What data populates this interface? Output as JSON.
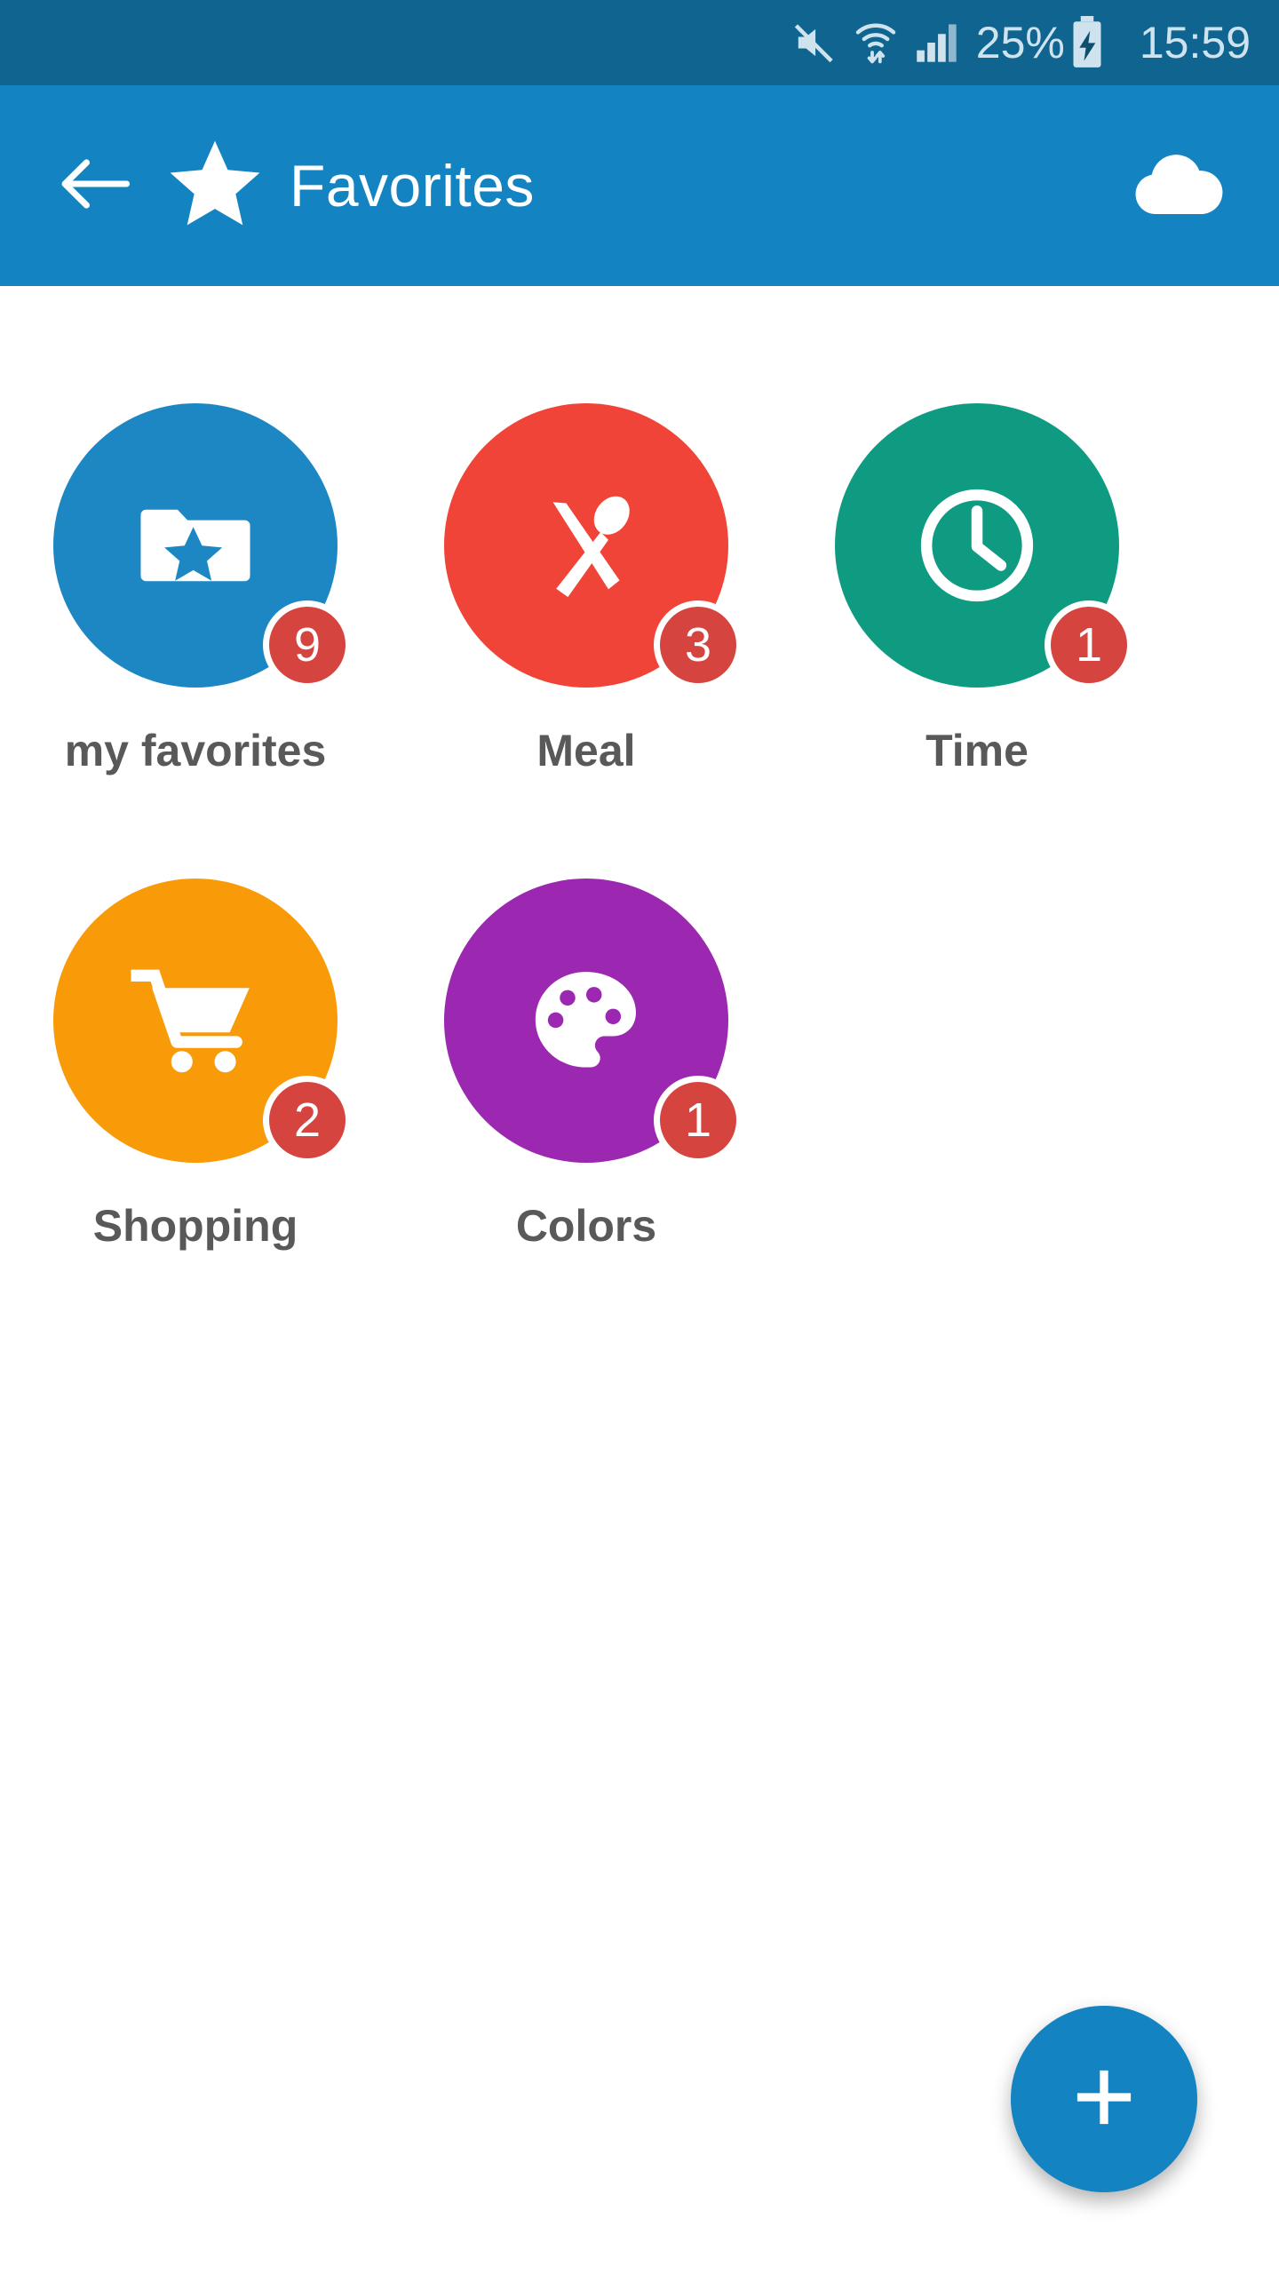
{
  "status_bar": {
    "background": "#0f6590",
    "text_color": "#cfe3ee",
    "mute_icon": "volume-mute-icon",
    "wifi_icon": "wifi-data-transfer-icon",
    "signal_icon": "cellular-signal-icon",
    "battery_percent": "25%",
    "battery_icon": "battery-charging-icon",
    "clock": "15:59"
  },
  "app_bar": {
    "background": "#1483c2",
    "back_icon": "arrow-left-icon",
    "logo_icon": "star-icon",
    "title": "Favorites",
    "action_icon": "cloud-download-icon"
  },
  "grid": {
    "items": [
      {
        "label": "my favorites",
        "color": "#1c87c2",
        "badge": "9",
        "icon": "folder-star-icon"
      },
      {
        "label": "Meal",
        "color": "#f04438",
        "badge": "3",
        "icon": "knife-spoon-icon"
      },
      {
        "label": "Time",
        "color": "#0f9b82",
        "badge": "1",
        "icon": "clock-icon"
      },
      {
        "label": "Shopping",
        "color": "#f99b08",
        "badge": "2",
        "icon": "shopping-cart-icon"
      },
      {
        "label": "Colors",
        "color": "#9c27b0",
        "badge": "1",
        "icon": "paint-palette-icon"
      }
    ],
    "badge_color": "#d6443f",
    "label_color": "#595959"
  },
  "fab": {
    "icon": "plus-icon",
    "color": "#1483c2"
  }
}
